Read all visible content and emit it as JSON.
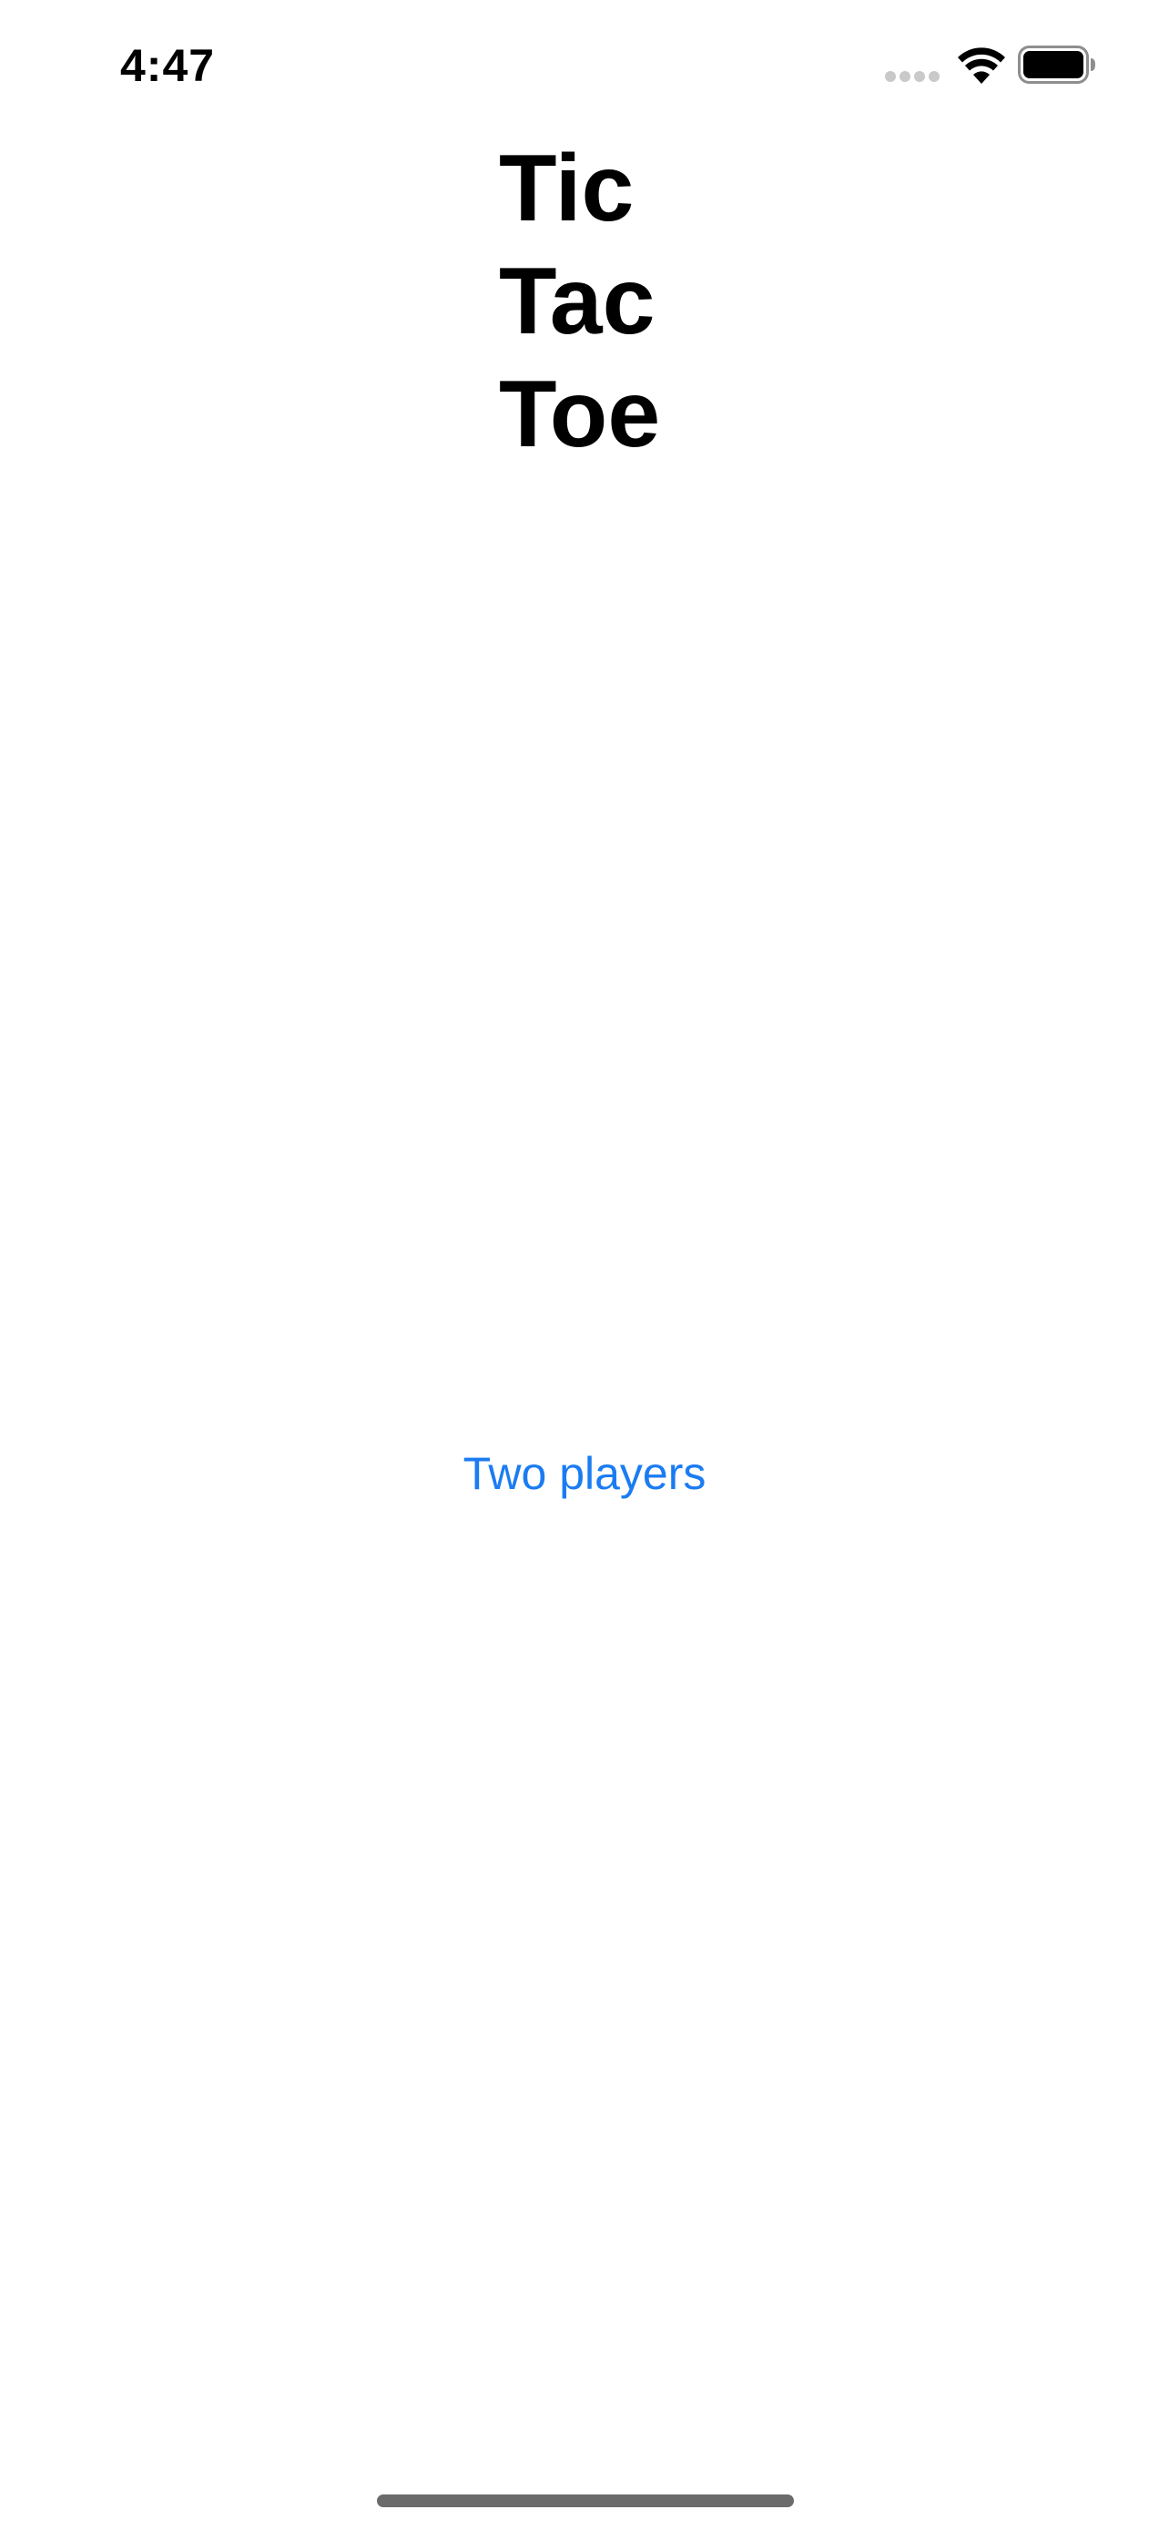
{
  "status_bar": {
    "time": "4:47",
    "icons": [
      "signal-dots-icon",
      "wifi-icon",
      "battery-icon"
    ]
  },
  "title": {
    "lines": [
      "Tic",
      "Tac",
      "Toe"
    ]
  },
  "main": {
    "two_players_label": "Two players"
  },
  "colors": {
    "accent": "#1b7cf2",
    "background": "#ffffff",
    "text": "#000000"
  }
}
